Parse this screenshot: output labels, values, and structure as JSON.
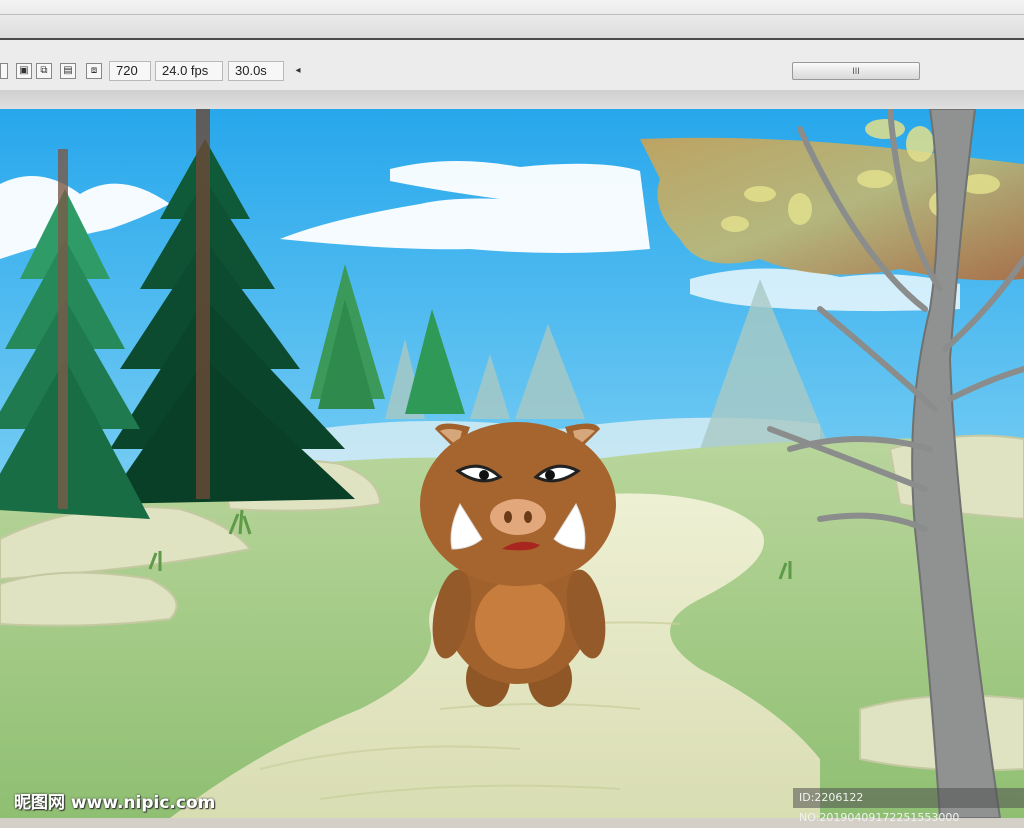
{
  "toolbar": {
    "icons": [
      {
        "name": "edit-scene-icon",
        "glyph": "▣"
      },
      {
        "name": "edit-symbol-icon",
        "glyph": "⧉"
      },
      {
        "name": "onion-skin-icon",
        "glyph": "▤"
      },
      {
        "name": "onion-outline-icon",
        "glyph": "⧈"
      }
    ],
    "frame": "720",
    "fps": "24.0 fps",
    "time": "30.0s",
    "scroll_left_glyph": "◂",
    "scroll_thumb_glyph": "III"
  },
  "colors": {
    "sky": "#3fb0ea",
    "grass": "#a9cf8e",
    "path": "#e4e6c3",
    "boar_body": "#a0612c",
    "tree_dark": "#0f4f33"
  },
  "watermark": {
    "brand": "昵图网 www.nipic.com",
    "id_text": "ID:2206122 NO:20190409172251553000"
  }
}
